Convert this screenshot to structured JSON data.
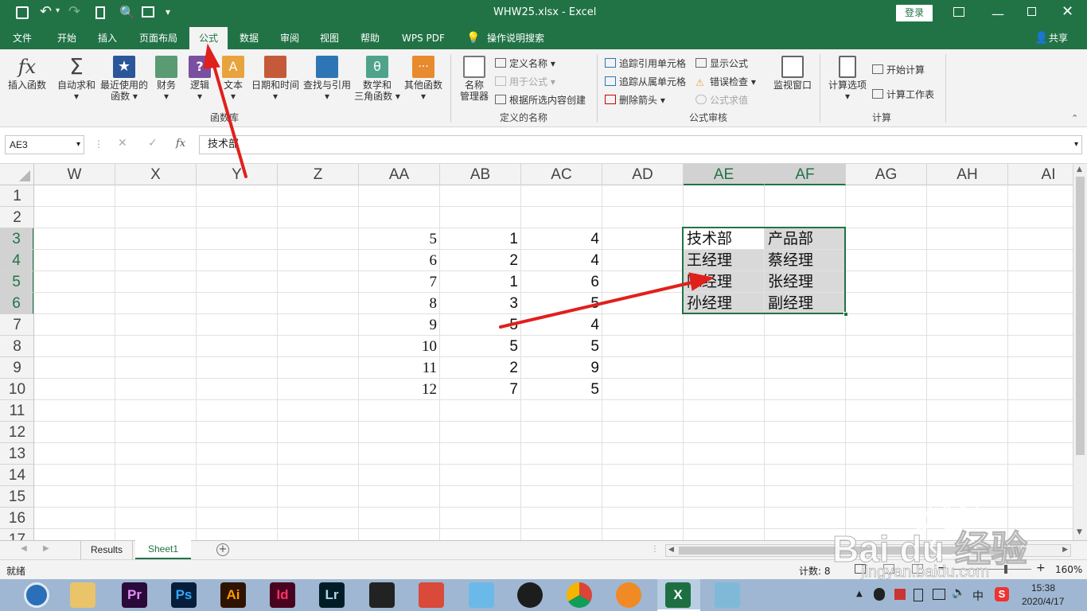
{
  "window": {
    "title": "WHW25.xlsx  -  Excel",
    "login_label": "登录",
    "share_label": "共享"
  },
  "ribbon_tabs": [
    {
      "label": "文件"
    },
    {
      "label": "开始"
    },
    {
      "label": "插入"
    },
    {
      "label": "页面布局"
    },
    {
      "label": "公式"
    },
    {
      "label": "数据"
    },
    {
      "label": "审阅"
    },
    {
      "label": "视图"
    },
    {
      "label": "帮助"
    },
    {
      "label": "WPS PDF"
    },
    {
      "label": "操作说明搜索"
    }
  ],
  "ribbon": {
    "function_library": {
      "group_label": "函数库",
      "insert_function": "插入函数",
      "autosum": "自动求和",
      "recent_1": "最近使用的",
      "recent_2": "函数",
      "financial": "财务",
      "logical": "逻辑",
      "text": "文本",
      "datetime": "日期和时间",
      "lookup": "查找与引用",
      "math_1": "数学和",
      "math_2": "三角函数",
      "more": "其他函数"
    },
    "defined_names": {
      "group_label": "定义的名称",
      "name_manager_1": "名称",
      "name_manager_2": "管理器",
      "define_name": "定义名称",
      "use_in_formula": "用于公式",
      "create_from_selection": "根据所选内容创建"
    },
    "formula_auditing": {
      "group_label": "公式审核",
      "trace_precedents": "追踪引用单元格",
      "trace_dependents": "追踪从属单元格",
      "remove_arrows": "删除箭头",
      "show_formulas": "显示公式",
      "error_checking": "错误检查",
      "evaluate_formula": "公式求值",
      "watch_window": "监视窗口"
    },
    "calculation": {
      "group_label": "计算",
      "calc_options": "计算选项",
      "calc_now": "开始计算",
      "calc_sheet": "计算工作表"
    }
  },
  "formula_bar": {
    "name_box": "AE3",
    "fx": "fx",
    "content": "技术部"
  },
  "columns": [
    "W",
    "X",
    "Y",
    "Z",
    "AA",
    "AB",
    "AC",
    "AD",
    "AE",
    "AF",
    "AG",
    "AH",
    "AI"
  ],
  "rows": [
    "1",
    "2",
    "3",
    "4",
    "5",
    "6",
    "7",
    "8",
    "9",
    "10",
    "11",
    "12",
    "13",
    "14",
    "15",
    "16",
    "17"
  ],
  "cells": {
    "AA": [
      "5",
      "6",
      "7",
      "8",
      "9",
      "10",
      "11",
      "12"
    ],
    "AB": [
      "1",
      "2",
      "1",
      "3",
      "5",
      "5",
      "2",
      "7"
    ],
    "AC": [
      "4",
      "4",
      "6",
      "5",
      "4",
      "5",
      "9",
      "5"
    ],
    "AE": [
      "技术部",
      "王经理",
      "陈经理",
      "孙经理"
    ],
    "AF": [
      "产品部",
      "蔡经理",
      "张经理",
      "副经理"
    ]
  },
  "sheets": [
    {
      "label": "Results"
    },
    {
      "label": "Sheet1"
    }
  ],
  "status": {
    "ready": "就绪",
    "count": "计数: 8",
    "zoom": "160%"
  },
  "watermark": {
    "line1": "Bai du 经验",
    "line2": "jingyan.baidu.com"
  },
  "taskbar": {
    "apps": [
      "Pr",
      "Ps",
      "Ai",
      "Id",
      "Lr"
    ],
    "ime": "中",
    "time": "15:38",
    "date": "2020/4/17"
  },
  "colors": {
    "excel_green": "#217346",
    "arrow_red": "#e0201c"
  }
}
